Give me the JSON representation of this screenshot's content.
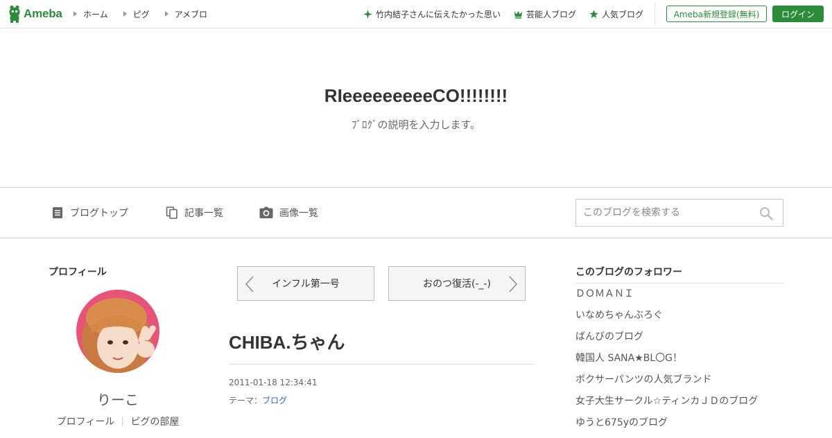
{
  "brand": {
    "logo_text": "Ameba",
    "accent": "#2d8c3c"
  },
  "top_nav": [
    {
      "label": "ホーム"
    },
    {
      "label": "ピグ"
    },
    {
      "label": "アメブロ"
    }
  ],
  "top_links": [
    {
      "label": "竹内結子さんに伝えたかった思い",
      "icon": "sparkle-icon"
    },
    {
      "label": "芸能人ブログ",
      "icon": "crown-icon"
    },
    {
      "label": "人気ブログ",
      "icon": "star-icon"
    }
  ],
  "account": {
    "register_label": "Ameba新規登録(無料)",
    "login_label": "ログイン"
  },
  "blog": {
    "title": "RIeeeeeeeeeCO!!!!!!!!",
    "description": "ﾌﾞﾛｸﾞの説明を入力します。"
  },
  "blog_nav": [
    {
      "label": "ブログトップ",
      "icon": "document-icon"
    },
    {
      "label": "記事一覧",
      "icon": "copy-icon"
    },
    {
      "label": "画像一覧",
      "icon": "camera-icon"
    }
  ],
  "search": {
    "placeholder": "このブログを検索する"
  },
  "profile": {
    "heading": "プロフィール",
    "name": "りーこ",
    "links": [
      "プロフィール",
      "ピグの部屋"
    ]
  },
  "pager": {
    "prev_label": "インフル第一号",
    "next_label": "おのつ復活(-_-)"
  },
  "entry": {
    "title": "CHIBA.ちゃん",
    "date": "2011-01-18 12:34:41",
    "theme_prefix": "テーマ：",
    "theme": "ブログ"
  },
  "followers": {
    "heading": "このブログのフォロワー",
    "items": [
      "ＤＯＭＡＮＩ",
      "いなめちゃんぶろぐ",
      "ばんびのブログ",
      "韓国人 SANA★BL〇G！",
      "ボクサーパンツの人気ブランド",
      "女子大生サークル☆ティンカＪＤのブログ",
      "ゆうと675yのブログ"
    ]
  }
}
